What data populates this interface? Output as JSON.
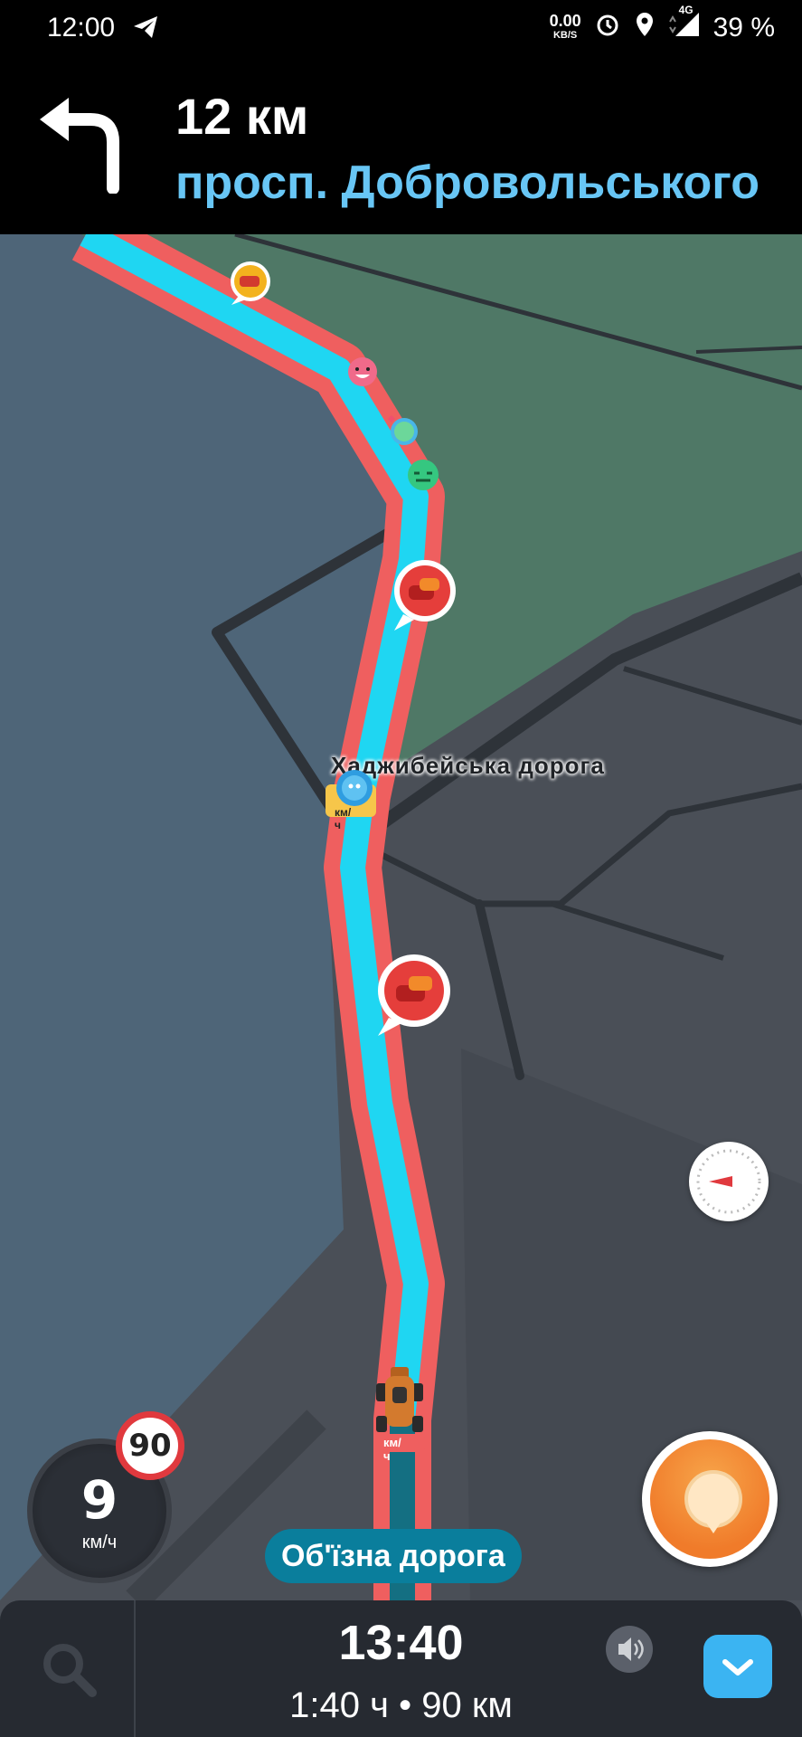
{
  "status_bar": {
    "time": "12:00",
    "net_speed": "0.00",
    "net_unit": "KB/S",
    "network": "4G",
    "battery": "39 %"
  },
  "navigation": {
    "distance": "12 км",
    "street": "просп. Добровольського"
  },
  "map": {
    "road_label": "Хаджибейська дорога",
    "speed_unit_marker": "км/ч",
    "colors": {
      "water": "#4e6578",
      "land": "#4a4f57",
      "park": "#4f7866",
      "route": "#1fd6f2",
      "traffic": "#ef5f5f"
    }
  },
  "speedometer": {
    "speed": "9",
    "unit": "км/ч",
    "speed_limit": "90"
  },
  "current_street": "Об'їзна дорога",
  "bottom_bar": {
    "eta": "13:40",
    "duration": "1:40 ч",
    "separator": "•",
    "distance": "90 км"
  }
}
